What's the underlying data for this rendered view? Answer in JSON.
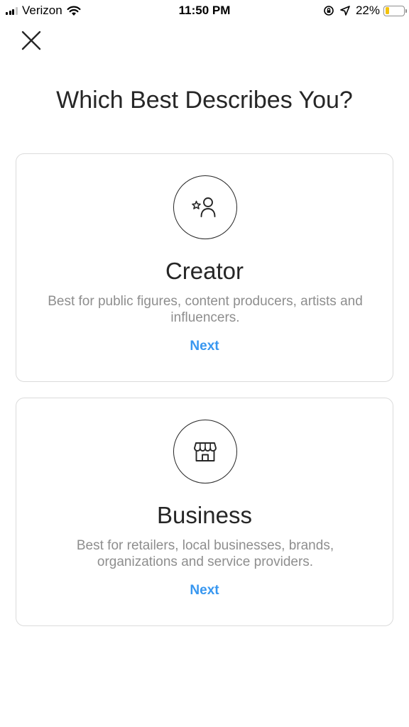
{
  "status_bar": {
    "carrier": "Verizon",
    "time": "11:50 PM",
    "battery_percent": "22%",
    "battery_level": 0.22,
    "battery_color": "#f3c20d"
  },
  "header": {
    "close_icon": "close-icon",
    "title": "Which Best Describes You?"
  },
  "cards": [
    {
      "icon": "creator-person-star-icon",
      "title": "Creator",
      "description": "Best for public figures, content producers, artists and influencers.",
      "action": "Next"
    },
    {
      "icon": "storefront-icon",
      "title": "Business",
      "description": "Best for retailers, local businesses, brands, organizations and service providers.",
      "action": "Next"
    }
  ],
  "colors": {
    "accent": "#3897f0",
    "text_primary": "#262626",
    "text_secondary": "#8e8e8e",
    "border": "#dbdbdb"
  }
}
